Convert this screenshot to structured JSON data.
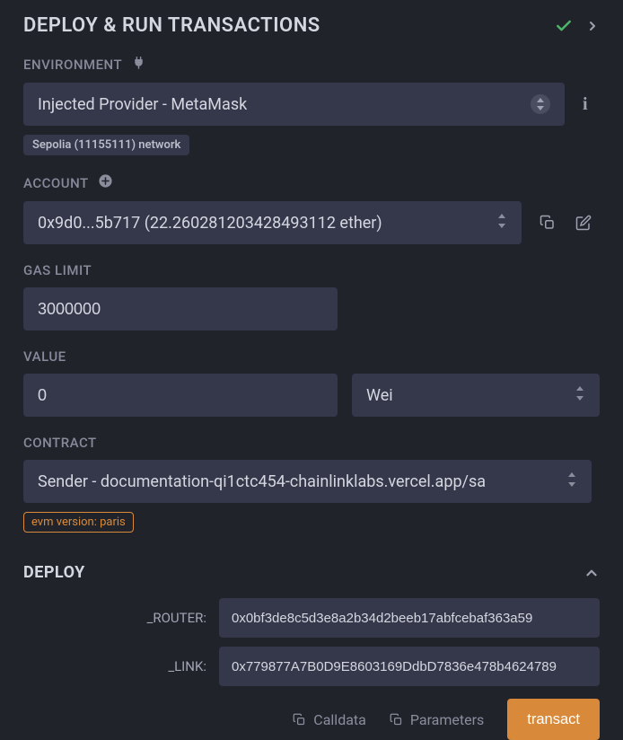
{
  "header": {
    "title": "DEPLOY & RUN TRANSACTIONS"
  },
  "environment": {
    "label": "ENVIRONMENT",
    "selected": "Injected Provider - MetaMask",
    "network_badge": "Sepolia (11155111) network"
  },
  "account": {
    "label": "ACCOUNT",
    "selected": "0x9d0...5b717 (22.260281203428493112 ether)"
  },
  "gas_limit": {
    "label": "GAS LIMIT",
    "value": "3000000"
  },
  "value": {
    "label": "VALUE",
    "amount": "0",
    "unit": "Wei"
  },
  "contract": {
    "label": "CONTRACT",
    "selected": "Sender - documentation-qi1ctc454-chainlinklabs.vercel.app/sa",
    "evm_badge": "evm version: paris"
  },
  "deploy": {
    "title": "DEPLOY",
    "params": [
      {
        "label": "_ROUTER:",
        "value": "0x0bf3de8c5d3e8a2b34d2beeb17abfcebaf363a59"
      },
      {
        "label": "_LINK:",
        "value": "0x779877A7B0D9E8603169DdbD7836e478b4624789"
      }
    ],
    "actions": {
      "calldata": "Calldata",
      "parameters": "Parameters",
      "transact": "transact"
    }
  }
}
